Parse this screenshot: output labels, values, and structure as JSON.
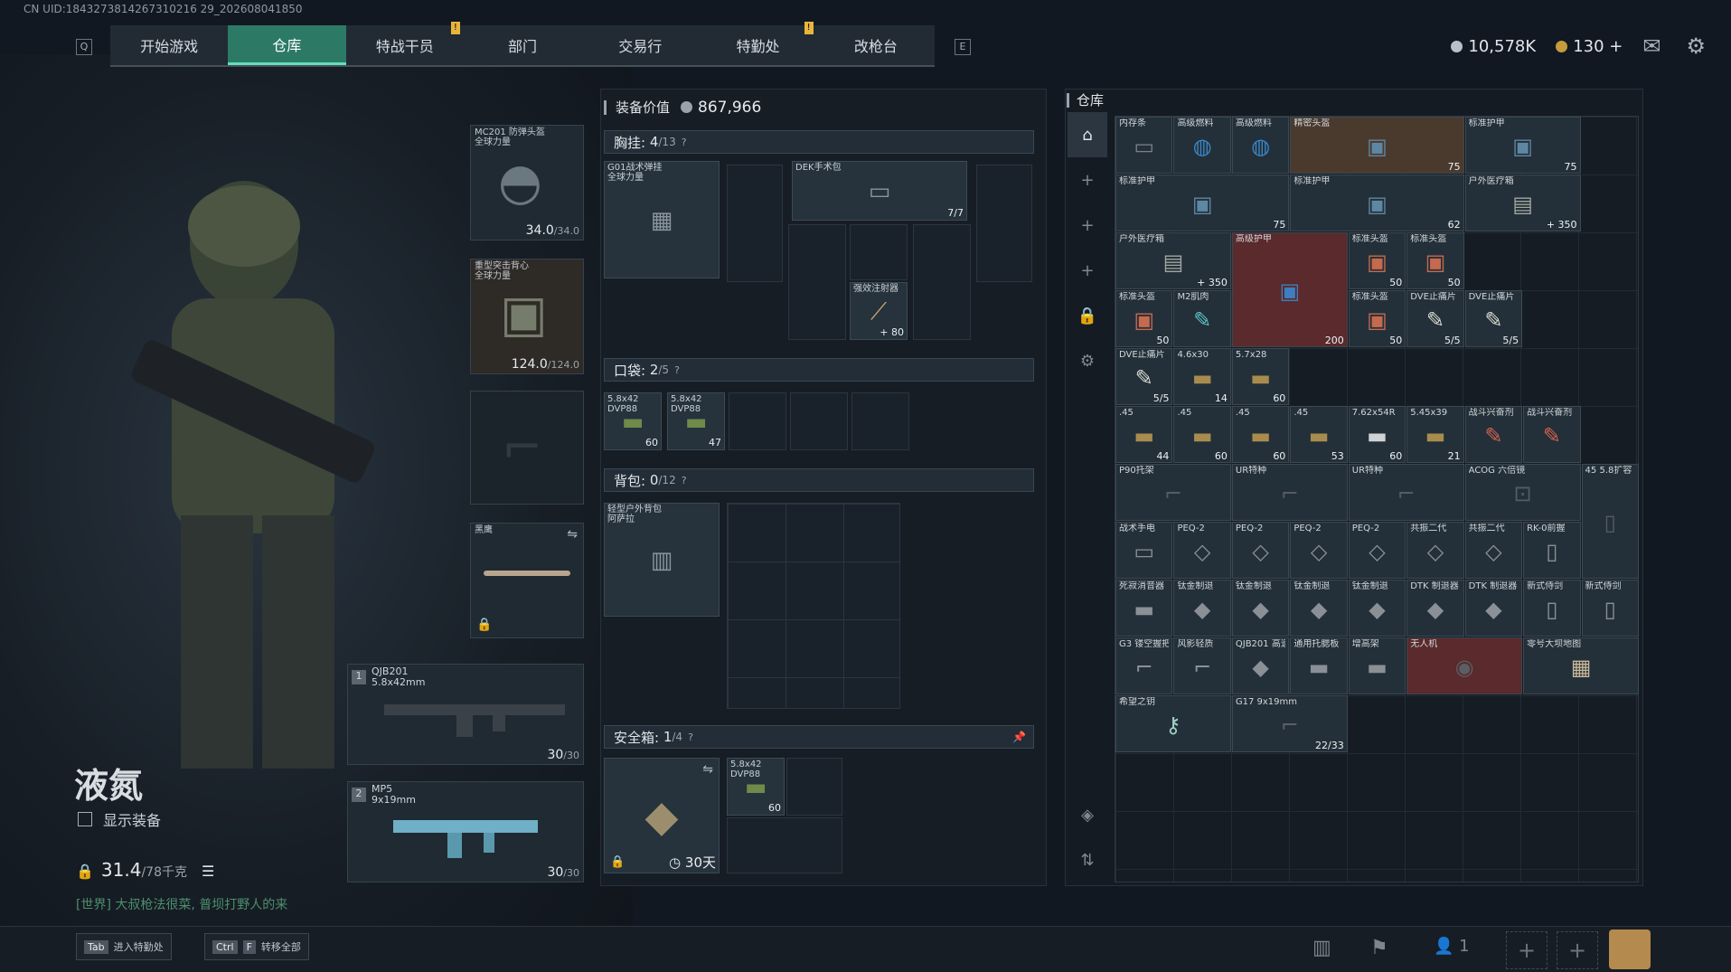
{
  "uid": "CN UID:1843273814267310216 29_202608041850",
  "tabs": [
    {
      "label": "开始游戏",
      "note": false
    },
    {
      "label": "仓库",
      "active": true,
      "note": false
    },
    {
      "label": "特战干员",
      "note": true
    },
    {
      "label": "部门",
      "note": false
    },
    {
      "label": "交易行",
      "note": false
    },
    {
      "label": "特勤处",
      "note": true
    },
    {
      "label": "改枪台",
      "note": false
    }
  ],
  "key_left": "Q",
  "key_right": "E",
  "currency": {
    "silver": "10,578K",
    "gold": "130 +"
  },
  "equip": {
    "value_label": "装备价值",
    "value": "867,966"
  },
  "helmet": {
    "name": "MC201 防弹头盔",
    "sub": "全球力量",
    "dur": "34.0",
    "max": "/34.0"
  },
  "armor": {
    "name": "重型突击背心",
    "sub": "全球力量",
    "dur": "124.0",
    "max": "/124.0"
  },
  "knife": {
    "name": "黑鹰"
  },
  "weapon1": {
    "slot": "1",
    "name": "QJB201",
    "cal": "5.8x42mm",
    "ammo": "30",
    "max": "/30"
  },
  "weapon2": {
    "slot": "2",
    "name": "MP5",
    "cal": "9x19mm",
    "ammo": "30",
    "max": "/30"
  },
  "operator": {
    "name": "液氮",
    "show_label": "显示装备",
    "weight": "31.4",
    "weight_max": "/78千克",
    "chat": "[世界] 大叔枪法很菜, 普坝打野人的来"
  },
  "chest": {
    "label": "胸挂:",
    "count": "4",
    "max": "/13",
    "rig": "G01战术弹挂",
    "rig_sub": "全球力量",
    "dek": "DEK手术包",
    "dek_q": "7/7",
    "inj": "强效注射器",
    "inj_q": "+ 80"
  },
  "pocket": {
    "label": "口袋:",
    "count": "2",
    "max": "/5",
    "a1": "5.8x42",
    "a1s": "DVP88",
    "a1q": "60",
    "a2": "5.8x42",
    "a2s": "DVP88",
    "a2q": "47"
  },
  "backpack": {
    "label": "背包:",
    "count": "0",
    "max": "/12",
    "name": "轻型户外背包",
    "sub": "阿萨拉"
  },
  "safe": {
    "label": "安全箱:",
    "count": "1",
    "max": "/4",
    "time": "30天",
    "ammo": "5.8x42",
    "ammos": "DVP88",
    "ammoq": "60"
  },
  "warehouse": {
    "title": "仓库",
    "items": [
      {
        "n": "内存条",
        "q": ""
      },
      {
        "n": "高级燃料",
        "q": ""
      },
      {
        "n": "高级燃料",
        "q": ""
      },
      {
        "n": "精密头盔",
        "q": "75"
      },
      {
        "n": "标准护甲",
        "q": "75"
      },
      {
        "n": "标准护甲",
        "q": "75"
      },
      {
        "n": "标准护甲",
        "q": "62"
      },
      {
        "n": "户外医疗箱",
        "q": "+ 350"
      },
      {
        "n": "户外医疗箱",
        "q": "+ 350"
      },
      {
        "n": "高级护甲",
        "q": "200"
      },
      {
        "n": "标准头盔",
        "q": "50"
      },
      {
        "n": "标准头盔",
        "q": "50"
      },
      {
        "n": "标准头盔",
        "q": "50"
      },
      {
        "n": "M2肌肉",
        "q": ""
      },
      {
        "n": "标准头盔",
        "q": "50"
      },
      {
        "n": "DVE止痛片",
        "q": "5/5"
      },
      {
        "n": "DVE止痛片",
        "q": "5/5"
      },
      {
        "n": "DVE止痛片",
        "q": "5/5"
      },
      {
        "n": "4.6x30",
        "q": "14"
      },
      {
        "n": "5.7x28",
        "q": "60"
      },
      {
        "n": ".45",
        "q": "44"
      },
      {
        "n": ".45",
        "q": "60"
      },
      {
        "n": ".45",
        "q": "60"
      },
      {
        "n": ".45",
        "q": "53"
      },
      {
        "n": "7.62x54R",
        "q": "60"
      },
      {
        "n": "5.45x39",
        "q": "21"
      },
      {
        "n": "战斗兴奋剂",
        "q": ""
      },
      {
        "n": "战斗兴奋剂",
        "q": ""
      },
      {
        "n": "P90托架",
        "q": ""
      },
      {
        "n": "UR特种",
        "q": ""
      },
      {
        "n": "UR特种",
        "q": ""
      },
      {
        "n": "ACOG 六倍镜",
        "q": ""
      },
      {
        "n": "45 5.8扩容",
        "q": ""
      },
      {
        "n": "战术手电",
        "q": ""
      },
      {
        "n": "PEQ-2",
        "q": ""
      },
      {
        "n": "PEQ-2",
        "q": ""
      },
      {
        "n": "PEQ-2",
        "q": ""
      },
      {
        "n": "PEQ-2",
        "q": ""
      },
      {
        "n": "共振二代",
        "q": ""
      },
      {
        "n": "共振二代",
        "q": ""
      },
      {
        "n": "RK-0前握",
        "q": ""
      },
      {
        "n": "死寂消音器",
        "q": ""
      },
      {
        "n": "钛金制退",
        "q": ""
      },
      {
        "n": "钛金制退",
        "q": ""
      },
      {
        "n": "钛金制退",
        "q": ""
      },
      {
        "n": "钛金制退",
        "q": ""
      },
      {
        "n": "DTK 制退器",
        "q": ""
      },
      {
        "n": "DTK 制退器",
        "q": ""
      },
      {
        "n": "新式侍剑",
        "q": ""
      },
      {
        "n": "新式侍剑",
        "q": ""
      },
      {
        "n": "G3 镂空握把",
        "q": ""
      },
      {
        "n": "风影轻质",
        "q": ""
      },
      {
        "n": "QJB201 高速导气",
        "q": ""
      },
      {
        "n": "通用托腮板",
        "q": ""
      },
      {
        "n": "增高架",
        "q": ""
      },
      {
        "n": "无人机",
        "q": ""
      },
      {
        "n": "零号大坝地图",
        "q": ""
      },
      {
        "n": "希望之钥",
        "q": ""
      },
      {
        "n": "G17 9x19mm",
        "q": "22/33"
      }
    ]
  },
  "bottom": {
    "tab_key": "Tab",
    "tab_label": "进入特勤处",
    "ctrl_key": "Ctrl",
    "f_key": "F",
    "f_label": "转移全部",
    "players": "1"
  },
  "colors": {
    "accent": "#2c7a66",
    "highlight": "#62e0b8",
    "red": "#5a2a2c"
  }
}
